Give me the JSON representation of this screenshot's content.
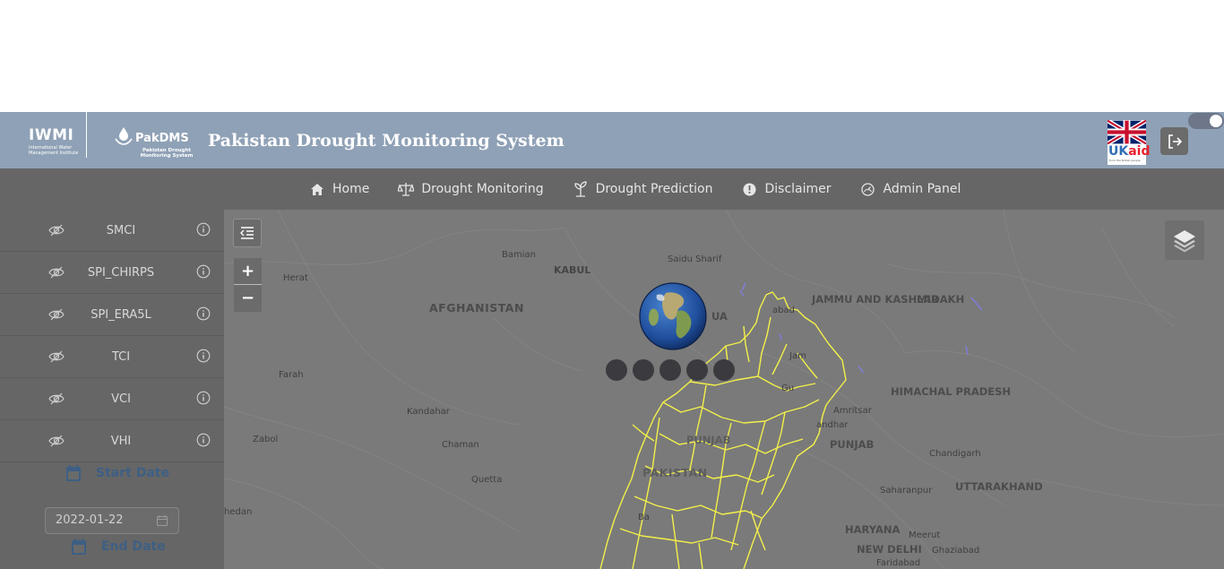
{
  "header": {
    "iwmi_logo": "IWMI",
    "iwmi_subtitle": "International Water Management Institute",
    "pakdms_logo": "PakDMS",
    "pakdms_subtitle": "Pakistan Drought Monitoring System",
    "title": "Pakistan Drought Monitoring System",
    "ukaid_uk": "UK",
    "ukaid_aid": "aid",
    "ukaid_small": "from the British people",
    "logout_icon": "logout-icon",
    "theme_toggle_on": true
  },
  "nav": {
    "items": [
      {
        "label": "Home",
        "icon": "home-icon"
      },
      {
        "label": "Drought Monitoring",
        "icon": "scale-icon"
      },
      {
        "label": "Drought Prediction",
        "icon": "plant-icon"
      },
      {
        "label": "Disclaimer",
        "icon": "info-circle-icon"
      },
      {
        "label": "Admin Panel",
        "icon": "dashboard-icon"
      }
    ]
  },
  "sidebar": {
    "layers": [
      {
        "name": "SMCI"
      },
      {
        "name": "SPI_CHIRPS"
      },
      {
        "name": "SPI_ERA5L"
      },
      {
        "name": "TCI"
      },
      {
        "name": "VCI"
      },
      {
        "name": "VHI"
      }
    ],
    "start_date_label": "Start Date",
    "start_date_value": "2022-01-22",
    "end_date_label": "End Date"
  },
  "map": {
    "zoom_in": "+",
    "zoom_out": "−",
    "labels": {
      "afghanistan": "AFGHANISTAN",
      "kabul": "KABUL",
      "bamian": "Bamian",
      "herat": "Herat",
      "farah": "Farah",
      "kandahar": "Kandahar",
      "zabol": "Zabol",
      "chaman": "Chaman",
      "quetta": "Quetta",
      "hedan": "hedan",
      "saidu_sharif": "Saidu Sharif",
      "jammu_kashmir": "JAMMU AND KASHMIR",
      "ladakh": "LADAKH",
      "himachal_pradesh": "HIMACHAL PRADESH",
      "amritsar": "Amritsar",
      "jalandhar": "Jalandhar",
      "punjab_in": "PUNJAB",
      "chandigarh": "Chandigarh",
      "saharanpur": "Saharanpur",
      "uttarakhand": "UTTARAKHAND",
      "haryana": "HARYANA",
      "meerut": "Meerut",
      "new_delhi": "NEW DELHI",
      "ghaziabad": "Ghaziabad",
      "faridabad": "Faridabad",
      "pakistan": "PAKISTAN",
      "punjab_pk": "PUNJAB",
      "islamabad_partial": "abad",
      "ua_partial": "UA",
      "jammu_partial": "Jam",
      "gujranwala_partial": "Gu",
      "bahawalpur_partial": "Ba",
      "jalandhar_partial": "andhar"
    }
  },
  "colors": {
    "header_bg": "#8fa1b6",
    "nav_bg": "#666666",
    "map_bg": "#7a7a7a",
    "boundary": "#f3f04a",
    "date_label": "#3e5f84"
  }
}
